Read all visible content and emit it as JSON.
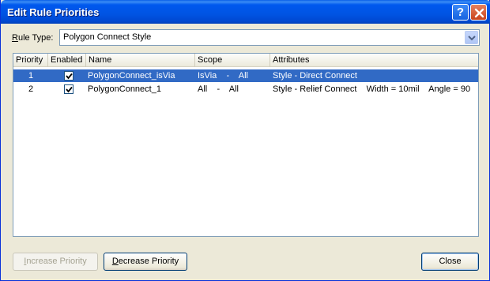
{
  "window": {
    "title": "Edit Rule Priorities",
    "help_glyph": "?"
  },
  "rule_type": {
    "label_accel": "R",
    "label_rest": "ule Type:",
    "value": "Polygon Connect Style"
  },
  "grid": {
    "columns": [
      "Priority",
      "Enabled",
      "Name",
      "Scope",
      "Attributes"
    ],
    "rows": [
      {
        "priority": "1",
        "enabled": true,
        "name": "PolygonConnect_isVia",
        "scope": "IsVia    -    All",
        "attributes": "Style - Direct Connect",
        "selected": true
      },
      {
        "priority": "2",
        "enabled": true,
        "name": "PolygonConnect_1",
        "scope": "All    -    All",
        "attributes": "Style - Relief Connect    Width = 10mil    Angle = 90    #",
        "selected": false
      }
    ]
  },
  "buttons": {
    "increase_accel": "I",
    "increase_rest": "ncrease Priority",
    "decrease_accel": "D",
    "decrease_rest": "ecrease Priority",
    "close": "Close"
  },
  "colors": {
    "titlebar": "#0054e3",
    "selection": "#316ac5",
    "dialog_bg": "#ece9d8"
  }
}
